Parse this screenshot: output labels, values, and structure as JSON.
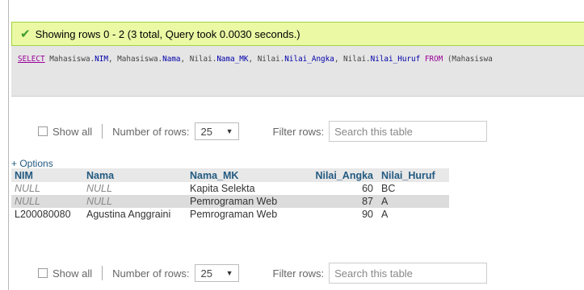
{
  "success_message": "Showing rows 0 - 2 (3 total, Query took 0.0030 seconds.)",
  "sql": {
    "select": "SELECT",
    "parts": [
      {
        "t": " Mahasiswa.",
        "c": "plain"
      },
      {
        "t": "NIM",
        "c": "col"
      },
      {
        "t": ", Mahasiswa.",
        "c": "plain"
      },
      {
        "t": "Nama",
        "c": "col"
      },
      {
        "t": ", Nilai.",
        "c": "plain"
      },
      {
        "t": "Nama_MK",
        "c": "col"
      },
      {
        "t": ", Nilai.",
        "c": "plain"
      },
      {
        "t": "Nilai_Angka",
        "c": "col"
      },
      {
        "t": ", Nilai.",
        "c": "plain"
      },
      {
        "t": "Nilai_Huruf",
        "c": "col"
      },
      {
        "t": " ",
        "c": "plain"
      },
      {
        "t": "FROM",
        "c": "kw"
      },
      {
        "t": " (Mahasiswa",
        "c": "plain"
      }
    ]
  },
  "nav": {
    "show_all": "Show all",
    "number_of_rows_label": "Number of rows:",
    "rows_value": "25",
    "filter_label": "Filter rows:",
    "search_placeholder": "Search this table"
  },
  "options_link": "+ Options",
  "table": {
    "headers": [
      "NIM",
      "Nama",
      "Nama_MK",
      "Nilai_Angka",
      "Nilai_Huruf"
    ],
    "rows": [
      [
        "NULL",
        "NULL",
        "Kapita Selekta",
        "60",
        "BC"
      ],
      [
        "NULL",
        "NULL",
        "Pemrograman Web",
        "87",
        "A"
      ],
      [
        "L200080080",
        "Agustina Anggraini",
        "Pemrograman Web",
        "90",
        "A"
      ]
    ]
  },
  "colors": {
    "success_bg": "#ebf8a4",
    "header_link": "#235a81",
    "keyword": "#990099",
    "column": "#0000aa"
  }
}
